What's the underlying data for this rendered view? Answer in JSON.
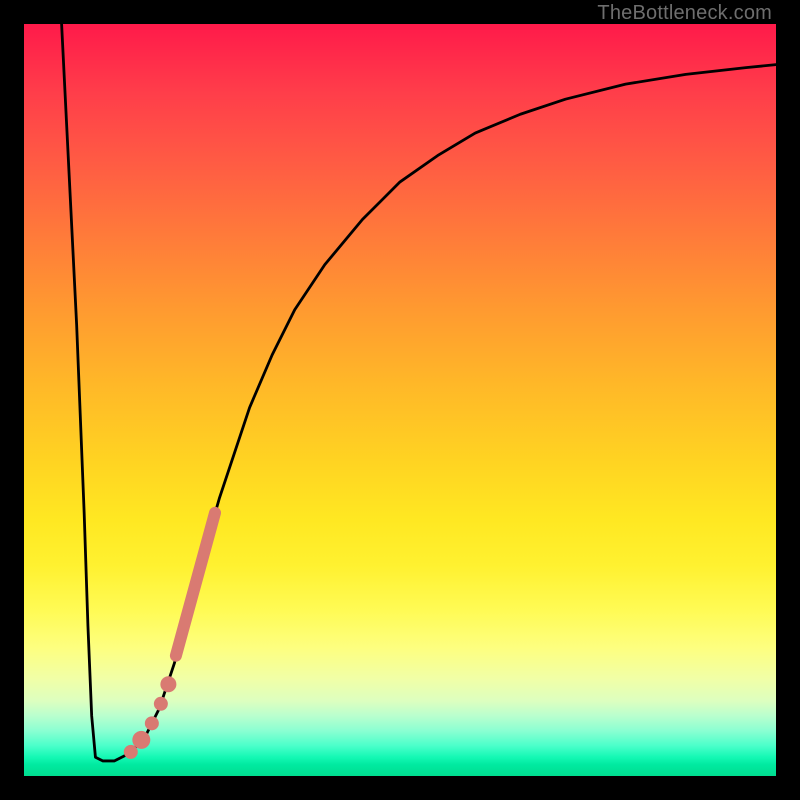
{
  "watermark": "TheBottleneck.com",
  "colors": {
    "frame": "#000000",
    "curve": "#000000",
    "marker": "#d97a72",
    "gradient_top": "#ff1a4a",
    "gradient_bottom": "#00dd90"
  },
  "chart_data": {
    "type": "line",
    "title": "",
    "xlabel": "",
    "ylabel": "",
    "xlim": [
      0,
      100
    ],
    "ylim": [
      0,
      100
    ],
    "grid": false,
    "legend": false,
    "note": "Axes have no visible tick labels; values below are read off pixel positions, normalised to 0–100 with (0,0) at bottom-left.",
    "series": [
      {
        "name": "curve",
        "x": [
          5,
          6,
          7,
          8,
          8.5,
          9,
          9.5,
          10.5,
          12,
          14,
          16,
          17,
          18,
          19,
          20,
          21,
          22,
          24,
          26,
          28,
          30,
          33,
          36,
          40,
          45,
          50,
          55,
          60,
          66,
          72,
          80,
          88,
          96,
          100
        ],
        "y": [
          100,
          80,
          60,
          35,
          20,
          8,
          2.5,
          2,
          2,
          3,
          5,
          7,
          9,
          12,
          15,
          19,
          23,
          30,
          37,
          43,
          49,
          56,
          62,
          68,
          74,
          79,
          82.5,
          85.5,
          88,
          90,
          92,
          93.3,
          94.2,
          94.6
        ]
      }
    ],
    "markers": [
      {
        "name": "thick-segment",
        "type": "line",
        "width": 12,
        "color": "#d97a72",
        "x": [
          20.2,
          25.4
        ],
        "y": [
          16,
          35
        ]
      },
      {
        "name": "dot-1",
        "type": "point",
        "r": 8,
        "color": "#d97a72",
        "x": 19.2,
        "y": 12.2
      },
      {
        "name": "dot-2",
        "type": "point",
        "r": 7,
        "color": "#d97a72",
        "x": 18.2,
        "y": 9.6
      },
      {
        "name": "dot-3",
        "type": "point",
        "r": 7,
        "color": "#d97a72",
        "x": 17.0,
        "y": 7.0
      },
      {
        "name": "dot-4",
        "type": "point",
        "r": 9,
        "color": "#d97a72",
        "x": 15.6,
        "y": 4.8
      },
      {
        "name": "dot-5",
        "type": "point",
        "r": 7,
        "color": "#d97a72",
        "x": 14.2,
        "y": 3.2
      }
    ]
  }
}
